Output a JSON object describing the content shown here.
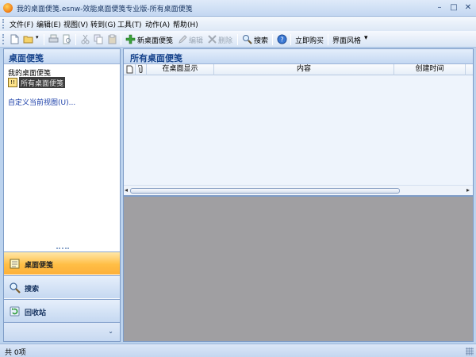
{
  "window": {
    "title": "我的桌面便笺.esnw-效能桌面便笺专业版-所有桌面便笺",
    "minimize": "–",
    "maximize": "□",
    "close": "✕"
  },
  "menu": [
    "文件(F)",
    "编辑(E)",
    "视图(V)",
    "转到(G)",
    "工具(T)",
    "动作(A)",
    "帮助(H)"
  ],
  "toolbar": {
    "new_note": "新桌面便笺",
    "edit": "编辑",
    "delete": "删除",
    "search": "搜索",
    "buy_now": "立即购买",
    "skin": "界面风格",
    "skin_arrow": "▾"
  },
  "left_pane": {
    "header": "桌面便笺",
    "tree_root": "我的桌面便笺",
    "tree_node": "所有桌面便笺",
    "node_icon_text": "!!",
    "custom_view_link": "自定义当前视图(U)...",
    "nav": [
      {
        "label": "桌面便笺",
        "icon": "note-icon",
        "active": true
      },
      {
        "label": "搜索",
        "icon": "search-icon",
        "active": false
      },
      {
        "label": "回收站",
        "icon": "recycle-icon",
        "active": false
      }
    ],
    "footer_chevron": "⌄"
  },
  "right_pane": {
    "header": "所有桌面便笺",
    "columns": [
      "",
      "",
      "在桌面显示",
      "内容",
      "创建时间"
    ]
  },
  "status": {
    "text": "共 0项"
  },
  "colors": {
    "accent_orange": "#ffbe45",
    "header_text": "#15428b",
    "preview_bg": "#a09fa2"
  }
}
